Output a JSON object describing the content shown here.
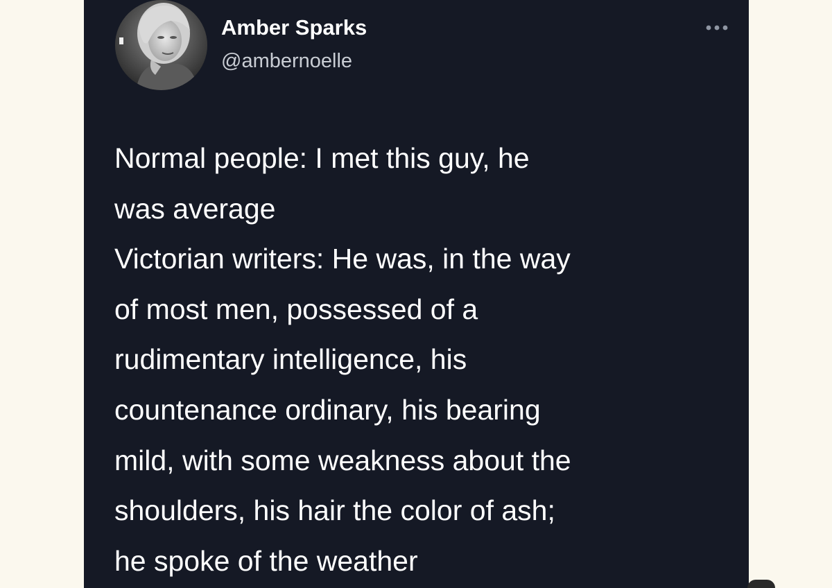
{
  "tweet": {
    "author": {
      "display_name": "Amber Sparks",
      "handle": "@ambernoelle",
      "avatar_icon": "profile-photo"
    },
    "more_icon": "more-horizontal-icon",
    "text_lines": [
      "Normal people: I met this guy, he",
      "was average",
      "Victorian writers: He was, in the way",
      "of most men, possessed of a",
      "rudimentary intelligence, his",
      "countenance ordinary, his bearing",
      "mild, with some weakness about the",
      "shoulders, his hair the color of ash;",
      "he spoke of the weather"
    ]
  },
  "colors": {
    "page_background": "#fbf8ee",
    "card_background": "#151925",
    "text_primary": "#ffffff",
    "text_secondary": "#c9cdd4"
  }
}
